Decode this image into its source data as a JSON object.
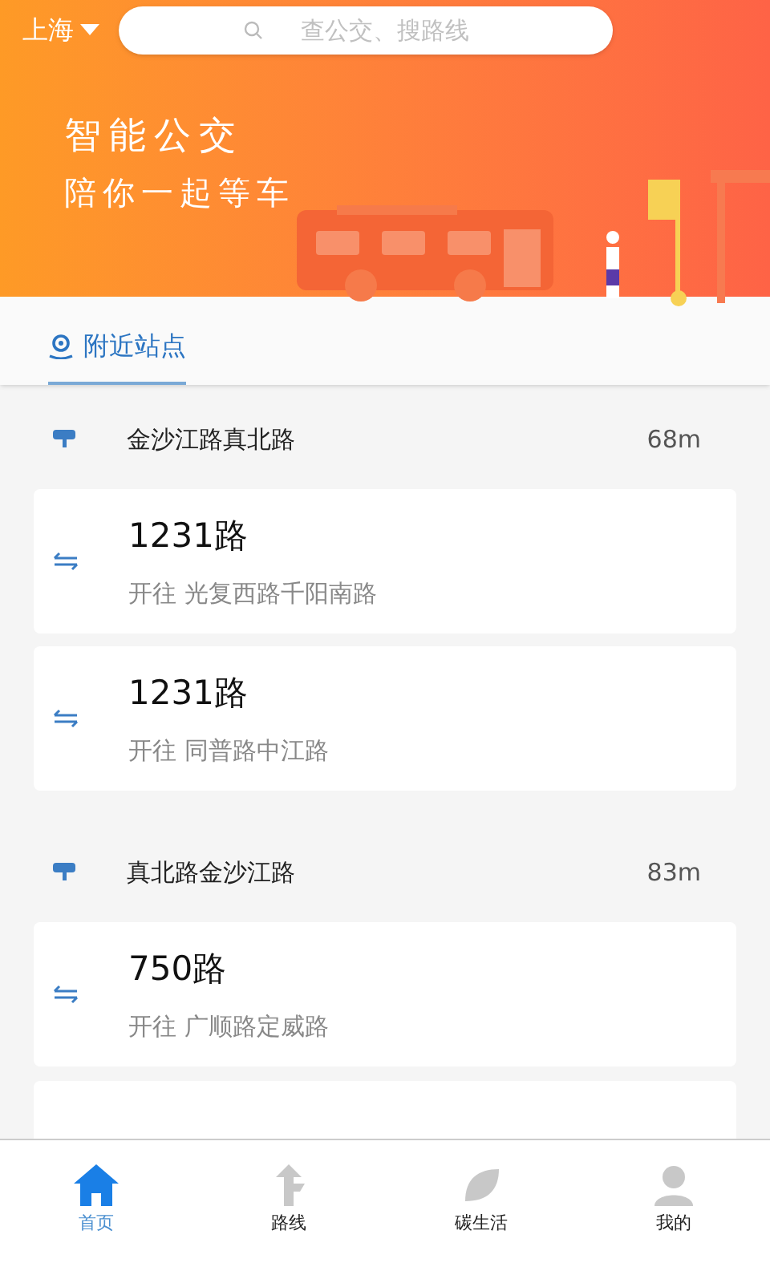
{
  "header": {
    "city": "上海",
    "search": {
      "placeholder": "查公交、搜路线"
    },
    "banner_title": "智能公交",
    "banner_subtitle": "陪你一起等车"
  },
  "tabs": [
    {
      "label": "附近站点",
      "selected": true
    }
  ],
  "stations": [
    {
      "name": "金沙江路真北路",
      "distance": "68m",
      "routes": [
        {
          "name": "1231路",
          "direction": "开往 光复西路千阳南路"
        },
        {
          "name": "1231路",
          "direction": "开往 同普路中江路"
        }
      ]
    },
    {
      "name": "真北路金沙江路",
      "distance": "83m",
      "routes": [
        {
          "name": "750路",
          "direction": "开往 广顺路定威路"
        }
      ]
    }
  ],
  "nav": [
    {
      "label": "首页",
      "kind": "home",
      "selected": true
    },
    {
      "label": "路线",
      "kind": "route",
      "selected": false
    },
    {
      "label": "碳生活",
      "kind": "leaf",
      "selected": false
    },
    {
      "label": "我的",
      "kind": "user",
      "selected": false
    }
  ]
}
